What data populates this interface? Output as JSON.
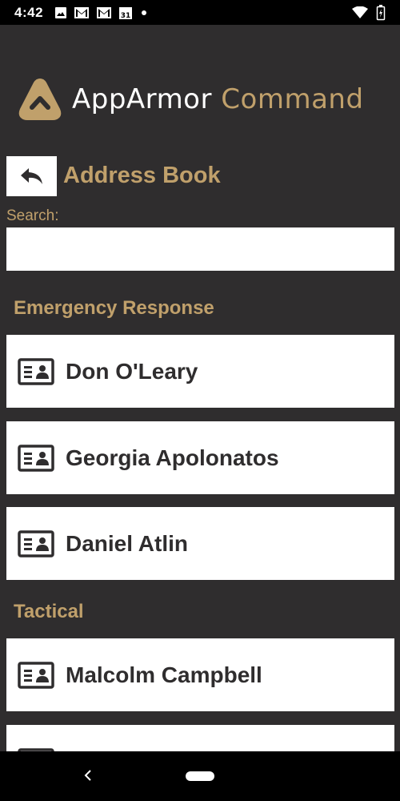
{
  "status_bar": {
    "time": "4:42",
    "notification_icons": [
      "photo-icon",
      "gmail-icon",
      "gmail-icon",
      "calendar-icon",
      "dot-icon"
    ],
    "calendar_day": "31"
  },
  "logo": {
    "brand_primary": "AppArmor",
    "brand_secondary": "Command"
  },
  "header": {
    "title": "Address Book",
    "back_icon": "reply-arrow-icon"
  },
  "search": {
    "label": "Search:",
    "value": "",
    "placeholder": ""
  },
  "sections": [
    {
      "title": "Emergency Response",
      "contacts": [
        "Don O'Leary",
        "Georgia Apolonatos",
        "Daniel Atlin"
      ]
    },
    {
      "title": "Tactical",
      "contacts": [
        "Malcolm Campbell",
        ""
      ]
    }
  ],
  "colors": {
    "background": "#2f2d2e",
    "accent": "#c0a06b",
    "card": "#ffffff"
  }
}
